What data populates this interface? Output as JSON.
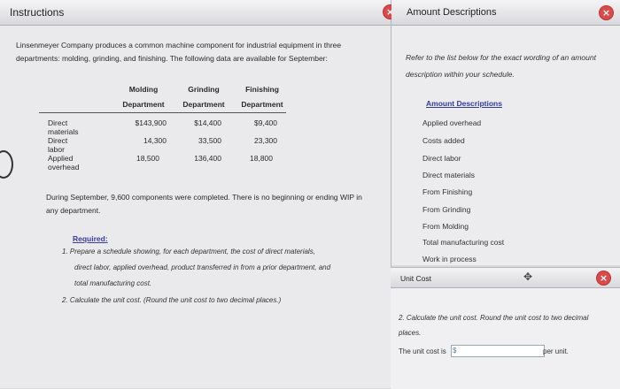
{
  "instructions": {
    "title": "Instructions",
    "intro": "Linsenmeyer Company produces a common machine component for industrial equipment in three departments: molding, grinding, and finishing. The following data are available for September:",
    "headers": [
      [
        "Molding",
        "Department"
      ],
      [
        "Grinding",
        "Department"
      ],
      [
        "Finishing",
        "Department"
      ]
    ],
    "rows": [
      {
        "label": "Direct materials",
        "values": [
          "$143,900",
          "$14,400",
          "$9,400"
        ]
      },
      {
        "label": "Direct labor",
        "values": [
          "14,300",
          "33,500",
          "23,300"
        ]
      },
      {
        "label": "Applied overhead",
        "values": [
          "18,500",
          "136,400",
          "18,800"
        ]
      }
    ],
    "note": "During September, 9,600 components were completed. There is no beginning or ending WIP in any department.",
    "required_title": "Required:",
    "req1_lines": [
      "1.  Prepare a schedule showing, for each department, the cost of direct materials,",
      "direct labor, applied overhead, product transferred in from a prior department, and",
      "total manufacturing cost."
    ],
    "req2": "2.  Calculate the unit cost. (Round the unit cost to two decimal places.)"
  },
  "amount_descriptions": {
    "title": "Amount Descriptions",
    "note": "Refer to the list below for the exact wording of an amount description within your schedule.",
    "list_heading": "Amount Descriptions",
    "items": [
      "Applied overhead",
      "Costs added",
      "Direct labor",
      "Direct materials",
      "From Finishing",
      "From Grinding",
      "From Molding",
      "Total manufacturing cost",
      "Work in process"
    ]
  },
  "unit_cost": {
    "title": "Unit Cost",
    "question": "2.  Calculate the unit cost. Round the unit cost to two decimal places.",
    "label": "The unit cost is",
    "currency": "$",
    "input_value": "",
    "suffix": "per unit."
  },
  "icons": {
    "close": "close-icon",
    "move": "move-icon"
  },
  "colors": {
    "close_red": "#d94a4a",
    "link_blue": "#333b9a"
  }
}
